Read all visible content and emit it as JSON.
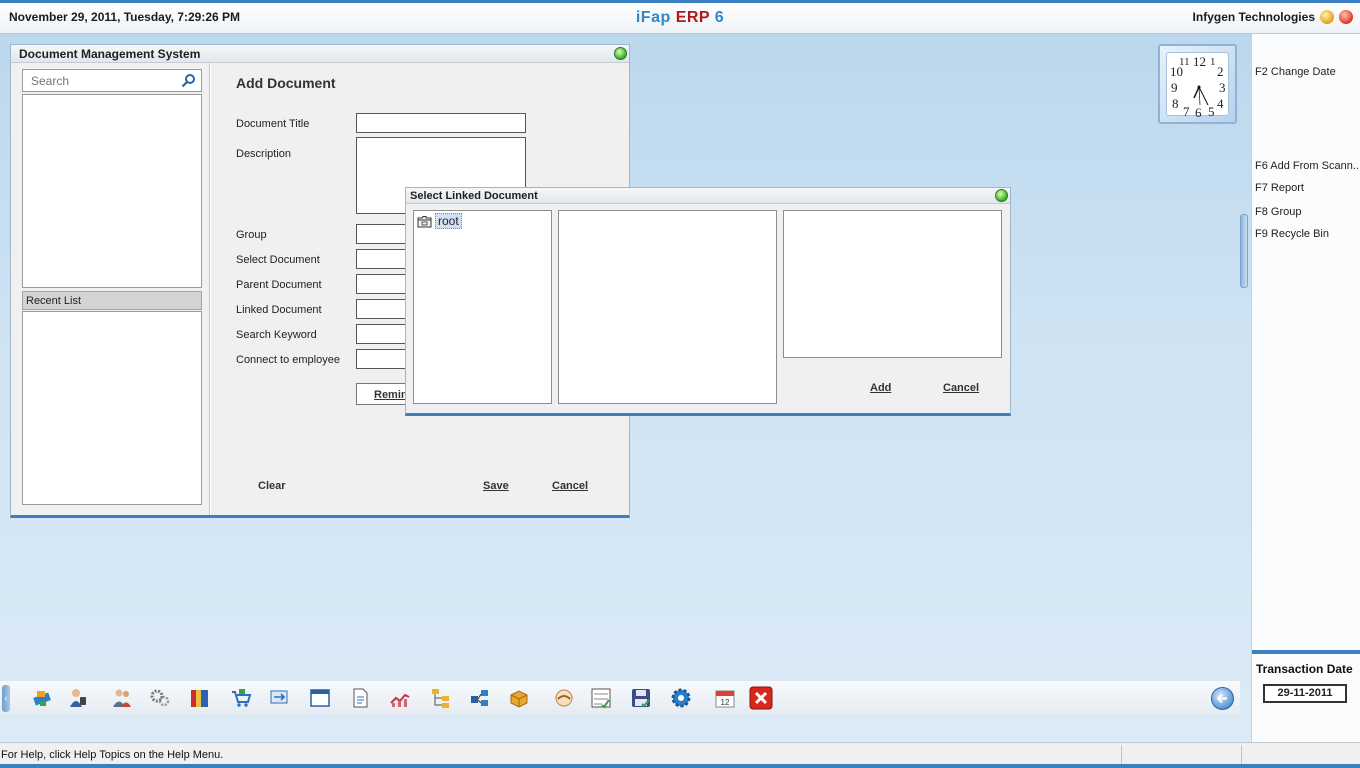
{
  "header": {
    "datetime": "November  29, 2011, Tuesday, 7:29:26 PM",
    "app_title_part1": "iFap",
    "app_title_part2": "ERP",
    "app_title_part3": "6",
    "company": "Infygen Technologies"
  },
  "clock": {
    "numbers": [
      "12",
      "1",
      "2",
      "3",
      "4",
      "5",
      "6",
      "7",
      "8",
      "9",
      "10",
      "11"
    ],
    "time": "7:29"
  },
  "dms_window": {
    "title": "Document Management System",
    "search": {
      "placeholder": "Search",
      "value": ""
    },
    "recent_list_label": "Recent List",
    "form": {
      "heading": "Add Document",
      "labels": {
        "document_title": "Document Title",
        "description": "Description",
        "group": "Group",
        "select_document": "Select Document",
        "parent_document": "Parent Document",
        "linked_document": "Linked Document",
        "search_keyword": "Search Keyword",
        "connect_employee": "Connect to employee"
      },
      "remind_button": "Remind",
      "clear_button": "Clear",
      "save_button": "Save",
      "cancel_button": "Cancel"
    }
  },
  "linked_dialog": {
    "title": "Select Linked Document",
    "tree_root": "root",
    "add_button": "Add",
    "cancel_button": "Cancel"
  },
  "right_panel": {
    "function_keys": [
      "F2 Change Date",
      "F6 Add From Scann...",
      "F7 Report",
      "F8 Group",
      "F9 Recycle Bin"
    ],
    "transaction_date_label": "Transaction Date",
    "transaction_date_value": "29-11-2011"
  },
  "taskbar": {
    "icons": [
      "network-icon",
      "user-phone-icon",
      "people-icon",
      "gears-icon",
      "books-icon",
      "cart-icon",
      "transfer-icon",
      "window-icon",
      "document-icon",
      "chart-icon",
      "hierarchy-icon",
      "flow-icon",
      "package-icon",
      "handshake-icon",
      "checklist-icon",
      "save-icon",
      "settings-icon",
      "calendar-icon",
      "exit-icon",
      "back-icon"
    ]
  },
  "status": {
    "help_text": "For Help, click Help Topics on the Help Menu."
  },
  "colors": {
    "accent": "#3a7fc0",
    "brand_blue": "#2a8ac8",
    "brand_red": "#b0181e",
    "desktop": "#cfe3f3"
  }
}
